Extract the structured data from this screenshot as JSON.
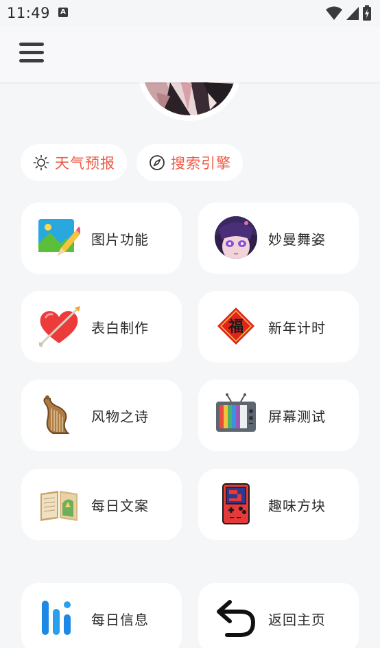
{
  "status_bar": {
    "time": "11:49",
    "a_badge": "A"
  },
  "chips": [
    {
      "label": "天气预报",
      "icon": "sun-icon"
    },
    {
      "label": "搜索引擎",
      "icon": "compass-icon"
    }
  ],
  "features": [
    {
      "label": "图片功能",
      "icon": "image-edit-icon"
    },
    {
      "label": "妙曼舞姿",
      "icon": "anime-girl-avatar-icon"
    },
    {
      "label": "表白制作",
      "icon": "heart-arrow-icon"
    },
    {
      "label": "新年计时",
      "icon": "fu-diamond-icon"
    },
    {
      "label": "风物之诗",
      "icon": "harp-icon"
    },
    {
      "label": "屏幕测试",
      "icon": "retro-tv-icon"
    },
    {
      "label": "每日文案",
      "icon": "open-book-icon"
    },
    {
      "label": "趣味方块",
      "icon": "game-console-icon"
    },
    {
      "label": "每日信息",
      "icon": "bar-logo-icon"
    },
    {
      "label": "返回主页",
      "icon": "return-arrow-icon"
    }
  ],
  "colors": {
    "accent": "#ef5b45",
    "background": "#f5f6f8",
    "card": "#ffffff"
  }
}
